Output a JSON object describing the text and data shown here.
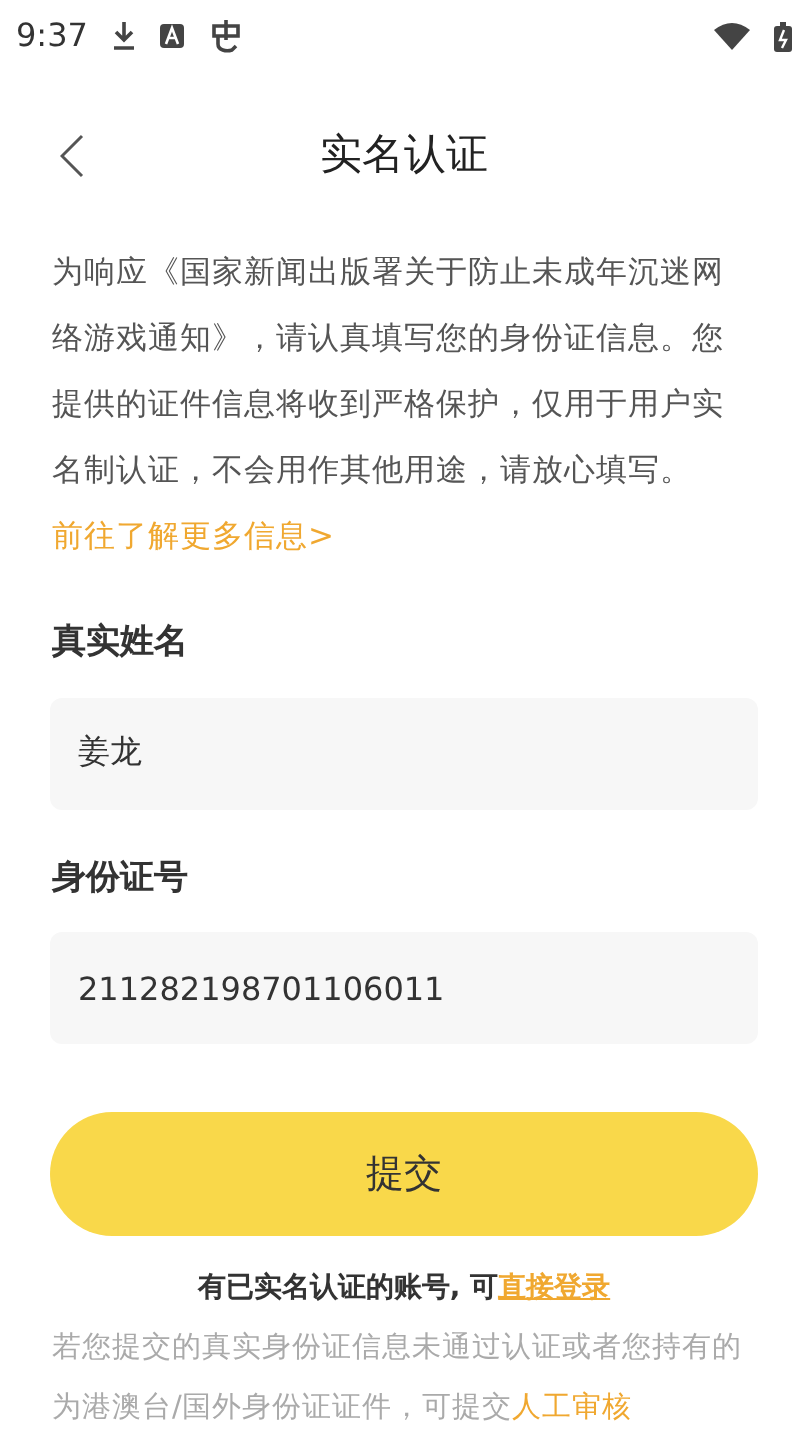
{
  "status_bar": {
    "time": "9:37"
  },
  "header": {
    "title": "实名认证"
  },
  "intro": {
    "text": "为响应《国家新闻出版署关于防止未成年沉迷网络游戏通知》，请认真填写您的身份证信息。您提供的证件信息将收到严格保护，仅用于用户实名制认证，不会用作其他用途，请放心填写。",
    "link": "前往了解更多信息>"
  },
  "fields": [
    {
      "label": "真实姓名",
      "value": "姜龙"
    },
    {
      "label": "身份证号",
      "value": "211282198701106011"
    }
  ],
  "submit_button": "提交",
  "login_prompt": {
    "text": "有已实名认证的账号, 可",
    "link": "直接登录"
  },
  "note": {
    "text": "若您提交的真实身份证信息未通过认证或者您持有的为港澳台/国外身份证证件，可提交",
    "link": "人工审核"
  }
}
